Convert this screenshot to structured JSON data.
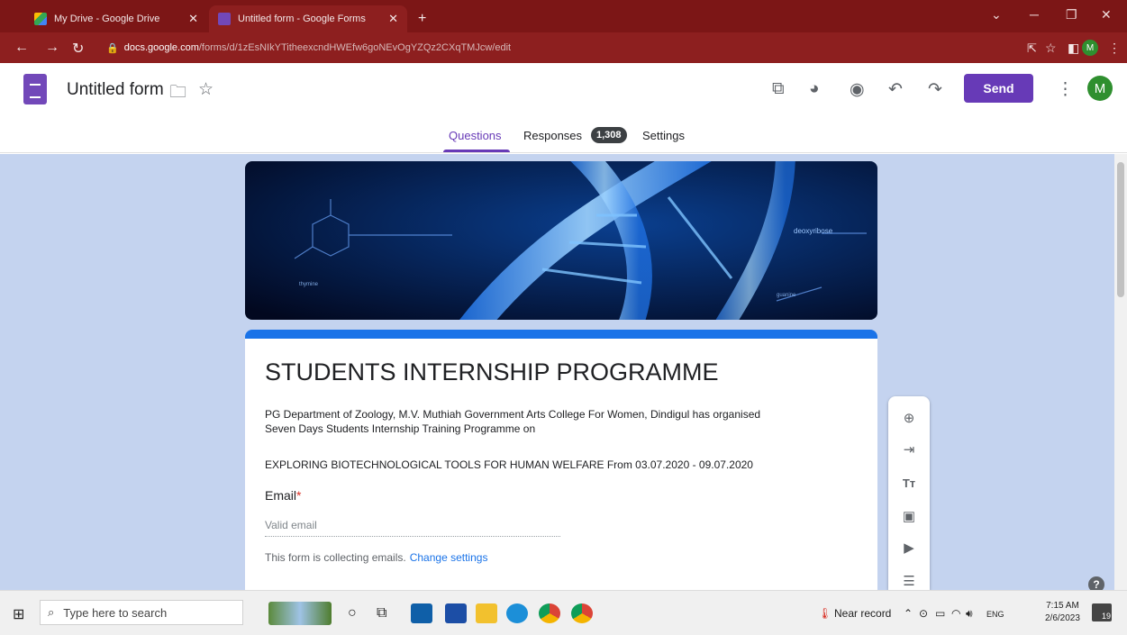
{
  "browser": {
    "tabs": [
      {
        "label": "My Drive - Google Drive",
        "favicon": "drive-icon",
        "active": false
      },
      {
        "label": "Untitled form - Google Forms",
        "favicon": "forms-icon",
        "active": true
      }
    ],
    "new_tab_label": "+",
    "url_host": "docs.google.com",
    "url_path": "/forms/d/1zEsNIkYTitheexcndHWEfw6goNEvOgYZQz2CXqTMJcw/edit"
  },
  "forms_header": {
    "title": "Untitled form",
    "send_label": "Send",
    "avatar_letter": "M",
    "nav": {
      "questions": "Questions",
      "responses": "Responses",
      "responses_count": "1,308",
      "settings": "Settings"
    }
  },
  "form": {
    "title": "STUDENTS INTERNSHIP PROGRAMME",
    "description_line1": "PG Department of Zoology, M.V. Muthiah Government Arts College For Women, Dindigul  has organised",
    "description_line2": "Seven Days Students Internship Training Programme on",
    "description_line3": "EXPLORING BIOTECHNOLOGICAL TOOLS FOR HUMAN WELFARE From   03.07.2020  - 09.07.2020",
    "email_label": "Email",
    "required_mark": "*",
    "email_placeholder": "Valid email",
    "collect_note": "This form is collecting emails.",
    "change_settings": "Change settings"
  },
  "banner": {
    "label_deoxyribose": "deoxyribose",
    "label_thymine": "thymine",
    "label_guanine": "guanine"
  },
  "taskbar": {
    "search_placeholder": "Type here to search",
    "weather": "Near record",
    "lang": "ENG",
    "time": "7:15 AM",
    "date": "2/6/2023",
    "notification_count": "19"
  },
  "colors": {
    "browser_frame": "#8d1f1f",
    "accent_purple": "#673ab7",
    "form_accent_blue": "#1a73e8",
    "canvas_bg": "#c4d3ef"
  }
}
